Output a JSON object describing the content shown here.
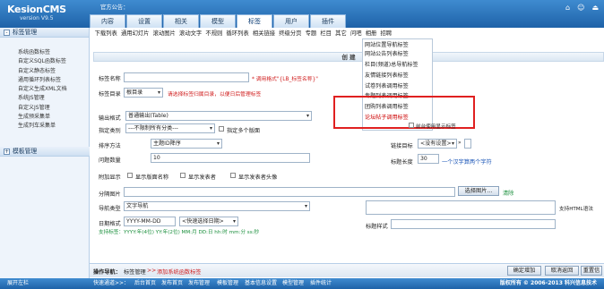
{
  "app": {
    "title": "KesionCMS",
    "version": "version V9.5",
    "announcement": "官方公告："
  },
  "tabs": [
    "内容",
    "设置",
    "相关",
    "模型",
    "标签",
    "用户",
    "插件"
  ],
  "sidebar": {
    "section1": "标签管理",
    "items": [
      "系统函数标签",
      "自定义SQL函数标签",
      "自定义静态标签",
      "通用循环列表标签",
      "自定义生成XML文档",
      "系统JS管理",
      "自定义JS管理",
      "生成预采集单",
      "生成列车采集单"
    ],
    "section2": "模板管理"
  },
  "toolbar": [
    "下载列表",
    "通用幻灯片",
    "滚动图片",
    "滚动文字",
    "不规则",
    "循环列表",
    "相关链接",
    "终级分页",
    "专题",
    "栏目",
    "其它",
    "问吧",
    "相册",
    "招聘"
  ],
  "form": {
    "banner": "创 建",
    "tag_name_label": "标签名称",
    "tag_name_hint": "* 调用格式\"{LB_标签名称}\"",
    "tag_dir_label": "标签目录",
    "tag_dir_value": "根目录",
    "tag_dir_hint": "请选择标签归属目录，以便日后管理标签",
    "output_label": "输出格式",
    "output_value": "普通输出(Table)",
    "category_label": "指定类别",
    "category_value": "---不限制所有分类---",
    "category_check": "指定多个版面",
    "sort_label": "排序方法",
    "sort_value": "主题ID降序",
    "count_label": "问题数量",
    "count_value": "10",
    "show_label": "附加显示",
    "show_opts": [
      "显示版面名称",
      "显示发表者",
      "显示发表者头像"
    ],
    "image_label": "分隔图片",
    "nav_label": "导航类型",
    "nav_value": "文字导航",
    "date_label": "日期格式",
    "date_value": "YYYY-MM-DD",
    "date_quick": "<快速选择日期>",
    "date_note": "支持标签：YYYY:年(4位) YY:年(2位) MM:月 DD:日 hh:时 mm:分 ss:秒",
    "link_label": "链接目标",
    "link_value": "<没有设置>",
    "title_len_label": "标题长度",
    "title_len_value": "30",
    "title_len_hint": "一个汉字算两个字符",
    "title_style_label": "标题样式",
    "select_image_btn": "选择图片...",
    "clear_label": "清除",
    "html_support": "支持HTML语法",
    "image_check": "前台使用显示标签"
  },
  "dropdown": [
    "网站位置导航标签",
    "网站公告列表标签",
    "栏目(频道)总导航标签",
    "友情链接列表标签",
    "试卷列表调用标签",
    "专题列表调用标签",
    "团购列表调用标签",
    "论坛帖子调用标签"
  ],
  "footer": {
    "breadcrumb_prefix": "操作导航：",
    "breadcrumb_part1": "标签管理",
    "breadcrumb_sep": ">>",
    "breadcrumb_part2": "添加系统函数标签",
    "buttons": [
      "确定增加",
      "取消返回",
      "重置信息"
    ]
  },
  "statusbar": {
    "left": "展开左栏",
    "quick": "快速通道>>：",
    "links": [
      "后台首页",
      "发布首页",
      "发布管理",
      "模板管理",
      "基本信息设置",
      "模型管理",
      "插件统计"
    ],
    "copyright": "版权所有 © 2006-2013 科兴信息技术"
  },
  "colors": {
    "accent": "#2471b8",
    "highlight_red": "#e02020"
  }
}
